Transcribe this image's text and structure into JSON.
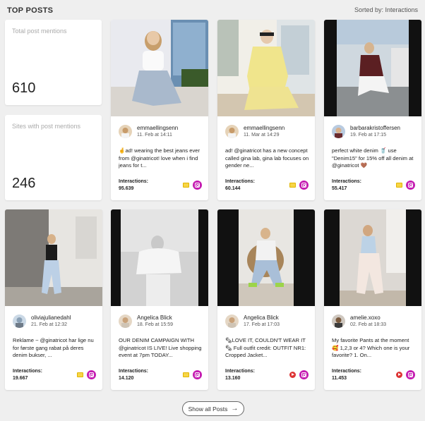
{
  "header": {
    "title": "TOP POSTS",
    "sort_label": "Sorted by: Interactions"
  },
  "stats": [
    {
      "label": "Total post mentions",
      "value": "610"
    },
    {
      "label": "Sites with post mentions",
      "value": "246"
    }
  ],
  "posts": [
    {
      "author": "emmaellingsenn",
      "date": "11. Feb at 14:11",
      "text": "🤞ad! wearing the best jeans ever from @ginatricot! love when i find jeans for t...",
      "interactions_label": "Interactions:",
      "interactions": "95.639",
      "media_icon": "image-icon",
      "platform_icon": "instagram-icon"
    },
    {
      "author": "emmaellingsenn",
      "date": "11. Mar at 14:29",
      "text": "ad! @ginatricot has a new concept called gina lab, gina lab focuses on gender ne...",
      "interactions_label": "Interactions:",
      "interactions": "60.144",
      "media_icon": "image-icon",
      "platform_icon": "instagram-icon"
    },
    {
      "author": "barbarakristoffersen",
      "date": "19. Feb at 17:15",
      "text": "perfect white denim 🥤 use \"Denim15\" for 15% off all denim at @ginatricot 🤎",
      "interactions_label": "Interactions:",
      "interactions": "55.417",
      "media_icon": "image-icon",
      "platform_icon": "instagram-icon"
    },
    {
      "author": "oliviajulianedahl",
      "date": "21. Feb at 12:32",
      "text": "Reklame ~ @ginatricot har lige nu for første gang rabat på deres denim bukser, ...",
      "interactions_label": "Interactions:",
      "interactions": "19.667",
      "media_icon": "image-icon",
      "platform_icon": "instagram-icon"
    },
    {
      "author": "Angelica Blick",
      "date": "18. Feb at 15:59",
      "text": "OUR DENIM CAMPAIGN WITH @ginatricot IS LIVE! Live shopping event at 7pm TODAY...",
      "interactions_label": "Interactions:",
      "interactions": "14.120",
      "media_icon": "image-icon",
      "platform_icon": "instagram-icon"
    },
    {
      "author": "Angelica Blick",
      "date": "17. Feb at 17:03",
      "text": "🗞LOVE IT, COULDN'T WEAR IT 🗞 Full outfit credit: OUTFIT NR1: Cropped Jacket...",
      "interactions_label": "Interactions:",
      "interactions": "13.160",
      "media_icon": "video-icon",
      "platform_icon": "instagram-icon"
    },
    {
      "author": "amelie.xoxo",
      "date": "02. Feb at 18:33",
      "text": "My favorite Pants at the moment 🥰 1,2,3 or 4? Which one is your favorite? 1. On...",
      "interactions_label": "Interactions:",
      "interactions": "11.453",
      "media_icon": "video-icon",
      "platform_icon": "instagram-icon"
    }
  ],
  "show_all": {
    "label": "Show all Posts",
    "arrow": "→"
  },
  "colors": {
    "instagram": "#c41cb1",
    "image_icon": "#f7d547",
    "video_icon": "#dd3333",
    "background": "#efefef"
  }
}
